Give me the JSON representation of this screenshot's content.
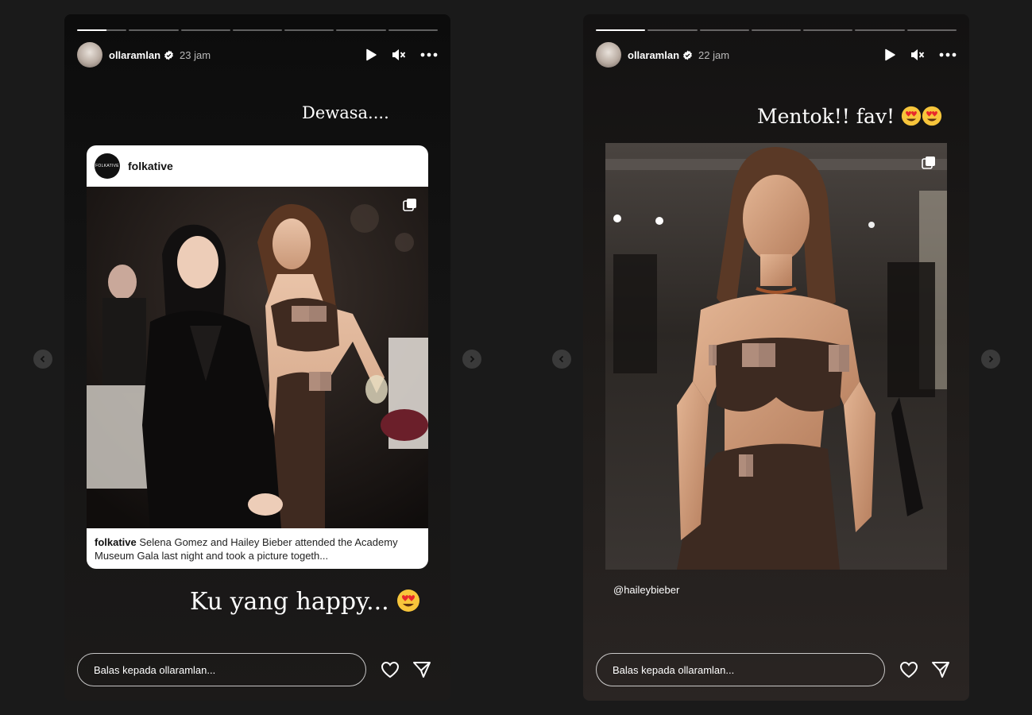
{
  "colors": {
    "page_bg": "#1a1a1a",
    "card_bg": "#ffffff",
    "mosaic": "#b08d7c"
  },
  "stories": [
    {
      "username": "ollaramlan",
      "time": "23 jam",
      "segments": 7,
      "active_segment": 1,
      "progress_fraction": 0.6,
      "caption_top": "Dewasa....",
      "caption_bottom": "Ku yang happy...",
      "post": {
        "account": "folkative",
        "avatar_text": "FOLKATIVE",
        "caption_user": "folkative",
        "caption_text": "Selena Gomez and Hailey Bieber attended the Academy Museum Gala last night and took a picture togeth..."
      },
      "reply_placeholder": "Balas kepada ollaramlan..."
    },
    {
      "username": "ollaramlan",
      "time": "22 jam",
      "segments": 7,
      "active_segment": 1,
      "progress_fraction": 1,
      "caption_top": "Mentok!! fav!",
      "mention": "@haileybieber",
      "reply_placeholder": "Balas kepada ollaramlan..."
    }
  ],
  "icons": [
    "verified-badge-icon",
    "play-icon",
    "mute-icon",
    "more-options-icon",
    "multiple-photos-icon",
    "heart-eyes-emoji",
    "heart-icon",
    "send-icon",
    "chevron-left-icon",
    "chevron-right-icon"
  ]
}
